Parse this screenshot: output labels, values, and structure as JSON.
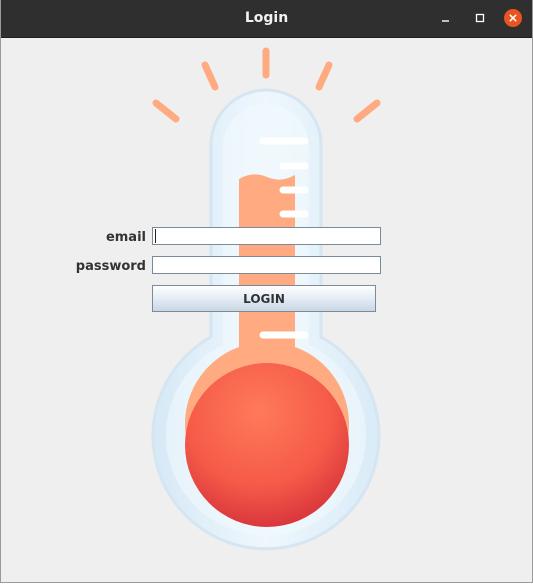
{
  "window": {
    "title": "Login"
  },
  "form": {
    "email_label": "email",
    "email_value": "",
    "password_label": "password",
    "password_value": "",
    "login_label": "LOGIN"
  },
  "icons": {
    "minimize": "minimize-icon",
    "maximize": "maximize-icon",
    "close": "close-icon",
    "background": "thermometer-icon"
  },
  "colors": {
    "titlebar": "#2f2f2f",
    "close_button": "#e95420",
    "background": "#efefef",
    "thermometer_liquid": "#ffaa80",
    "thermometer_bulb": "#f0584a",
    "rays": "#ffaa80"
  }
}
